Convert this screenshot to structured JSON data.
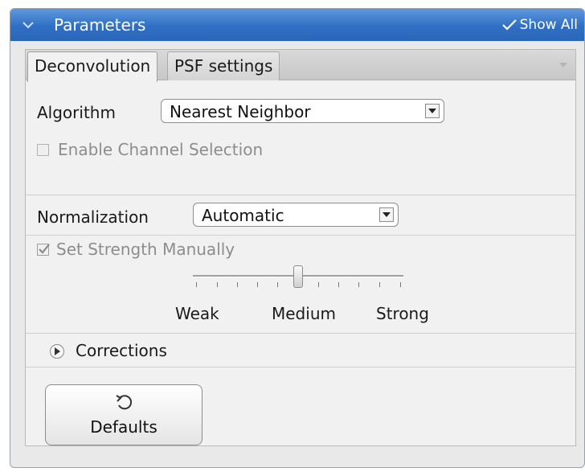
{
  "panel": {
    "title": "Parameters",
    "show_all": "Show All"
  },
  "tabs": [
    {
      "label": "Deconvolution",
      "active": true
    },
    {
      "label": "PSF settings",
      "active": false
    }
  ],
  "algorithm": {
    "label": "Algorithm",
    "value": "Nearest Neighbor"
  },
  "channel_selection": {
    "label": "Enable Channel Selection",
    "checked": false,
    "enabled": false
  },
  "normalization": {
    "label": "Normalization",
    "value": "Automatic"
  },
  "strength": {
    "checkbox_label": "Set Strength Manually",
    "checked": true,
    "enabled": false,
    "slider_labels": [
      "Weak",
      "Medium",
      "Strong"
    ],
    "slider_value_fraction": 0.5
  },
  "corrections": {
    "label": "Corrections",
    "expanded": false
  },
  "defaults_button": {
    "label": "Defaults",
    "icon": "undo-icon"
  },
  "colors": {
    "titlebar": "#2f6fc3",
    "panel_bg": "#e9e9e9",
    "content_bg": "#f1f1f1"
  }
}
